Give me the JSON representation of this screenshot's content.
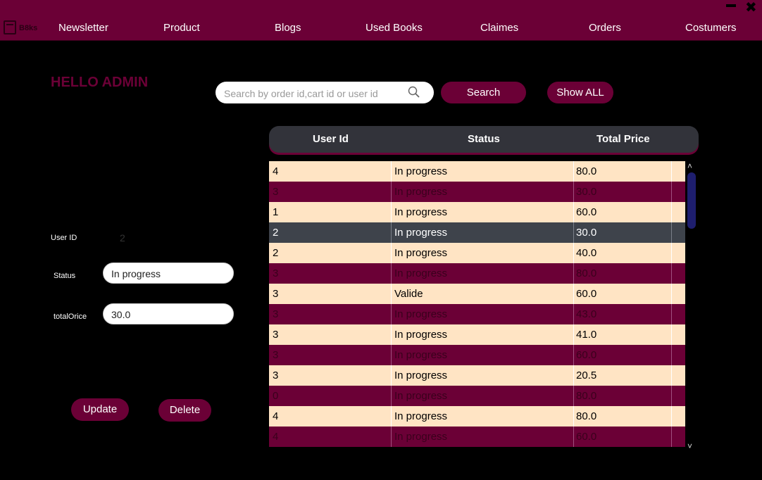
{
  "app": {
    "logo_text": "B8ks"
  },
  "nav": {
    "items": [
      "Newsletter",
      "Product",
      "Blogs",
      "Used Books",
      "Claimes",
      "Orders",
      "Costumers"
    ]
  },
  "window": {
    "minimize_label": "",
    "close_label": "✖"
  },
  "greeting": "HELLO ADMIN",
  "search": {
    "placeholder": "Search by order id,cart id or user id",
    "value": "",
    "button_label": "Search",
    "show_all_label": "Show ALL"
  },
  "form": {
    "user_id_label": "User ID",
    "user_id_value": "2",
    "status_label": "Status",
    "status_value": "In progress",
    "total_label": "totalOrice",
    "total_value": "30.0",
    "update_label": "Update",
    "delete_label": "Delete"
  },
  "table": {
    "columns": [
      "User Id",
      "Status",
      "Total Price"
    ],
    "selected_row": 3,
    "rows": [
      {
        "user_id": "4",
        "status": "In progress",
        "total": "80.0"
      },
      {
        "user_id": "3",
        "status": "In progress",
        "total": "30.0"
      },
      {
        "user_id": "1",
        "status": "In progress",
        "total": "60.0"
      },
      {
        "user_id": "2",
        "status": "In progress",
        "total": "30.0"
      },
      {
        "user_id": "2",
        "status": "In progress",
        "total": "40.0"
      },
      {
        "user_id": "3",
        "status": "In progress",
        "total": "80.0"
      },
      {
        "user_id": "3",
        "status": "Valide",
        "total": "60.0"
      },
      {
        "user_id": "3",
        "status": "In progress",
        "total": "43.0"
      },
      {
        "user_id": "3",
        "status": "In progress",
        "total": "41.0"
      },
      {
        "user_id": "3",
        "status": "In progress",
        "total": "60.0"
      },
      {
        "user_id": "3",
        "status": "In progress",
        "total": "20.5"
      },
      {
        "user_id": "0",
        "status": "In progress",
        "total": "80.0"
      },
      {
        "user_id": "4",
        "status": "In progress",
        "total": "80.0"
      },
      {
        "user_id": "4",
        "status": "In progress",
        "total": "60.0"
      }
    ]
  },
  "colors": {
    "brand": "#6b0036",
    "row_light": "#ffe4c4",
    "row_selected": "#3e434b",
    "header": "#32333a"
  }
}
